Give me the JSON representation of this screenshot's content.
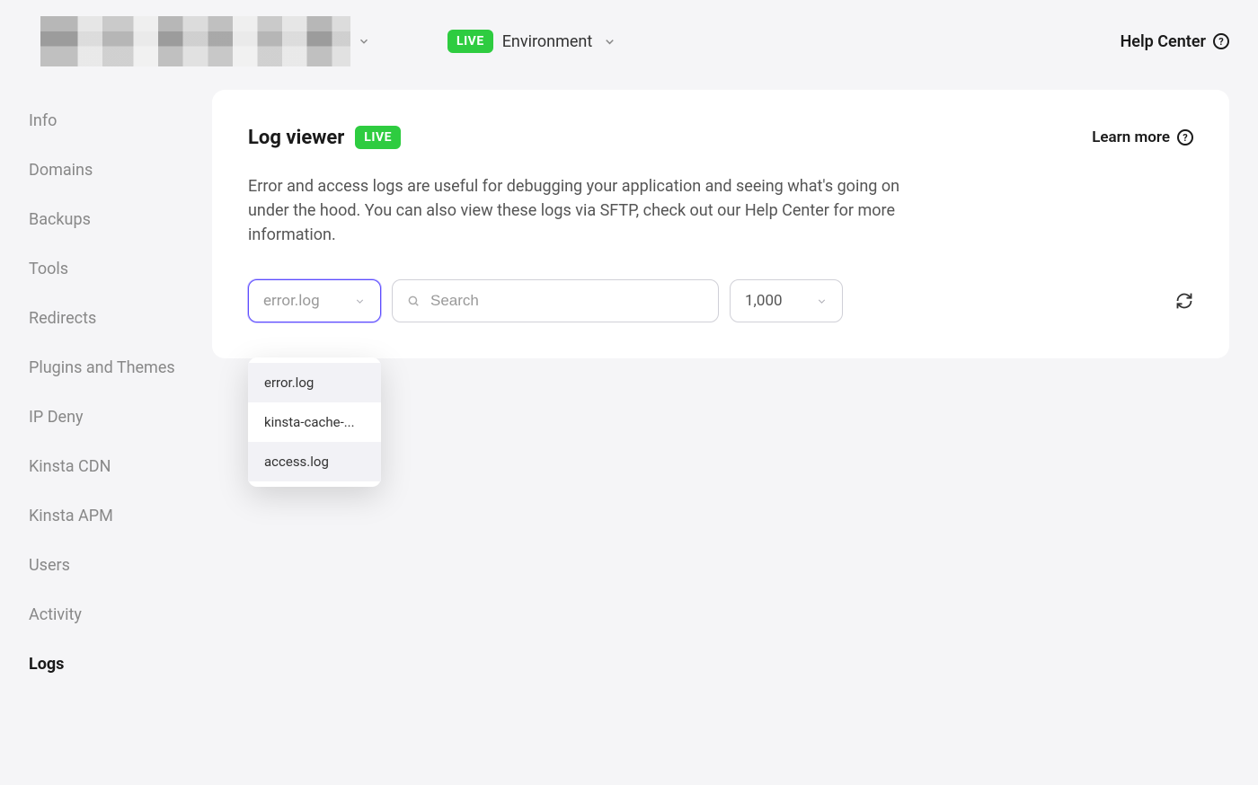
{
  "topbar": {
    "live_badge": "LIVE",
    "environment_label": "Environment",
    "help_center_label": "Help Center"
  },
  "sidebar": {
    "items": [
      {
        "label": "Info",
        "active": false
      },
      {
        "label": "Domains",
        "active": false
      },
      {
        "label": "Backups",
        "active": false
      },
      {
        "label": "Tools",
        "active": false
      },
      {
        "label": "Redirects",
        "active": false
      },
      {
        "label": "Plugins and Themes",
        "active": false
      },
      {
        "label": "IP Deny",
        "active": false
      },
      {
        "label": "Kinsta CDN",
        "active": false
      },
      {
        "label": "Kinsta APM",
        "active": false
      },
      {
        "label": "Users",
        "active": false
      },
      {
        "label": "Activity",
        "active": false
      },
      {
        "label": "Logs",
        "active": true
      }
    ]
  },
  "panel": {
    "title": "Log viewer",
    "live_badge": "LIVE",
    "learn_more": "Learn more",
    "description": "Error and access logs are useful for debugging your application and seeing what's going on under the hood. You can also view these logs via SFTP, check out our Help Center for more information."
  },
  "controls": {
    "log_select": {
      "placeholder": "error.log",
      "options": [
        {
          "label": "error.log"
        },
        {
          "label": "kinsta-cache-..."
        },
        {
          "label": "access.log"
        }
      ],
      "open": true,
      "highlighted_index": 0
    },
    "search": {
      "placeholder": "Search",
      "value": ""
    },
    "count_select": {
      "value": "1,000"
    }
  }
}
